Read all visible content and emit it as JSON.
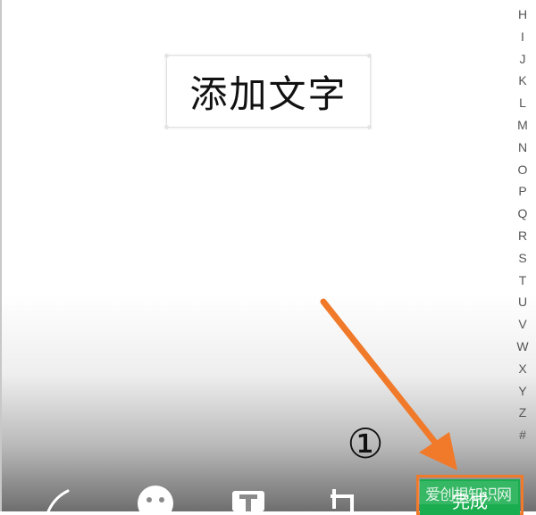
{
  "canvas": {
    "text_overlay": "添加文字"
  },
  "index_bar": {
    "letters": [
      "H",
      "I",
      "J",
      "K",
      "L",
      "M",
      "N",
      "O",
      "P",
      "Q",
      "R",
      "S",
      "T",
      "U",
      "V",
      "W",
      "X",
      "Y",
      "Z",
      "#"
    ]
  },
  "annotation": {
    "step_label": "①",
    "arrow_color": "#f07a2a"
  },
  "toolbar": {
    "tools": [
      {
        "icon": "pen-icon"
      },
      {
        "icon": "emoji-icon"
      },
      {
        "icon": "text-icon"
      },
      {
        "icon": "crop-icon"
      }
    ],
    "done_label": "完成",
    "done_color": "#1aad4f"
  },
  "watermark": {
    "text": "爱创根知识网"
  }
}
